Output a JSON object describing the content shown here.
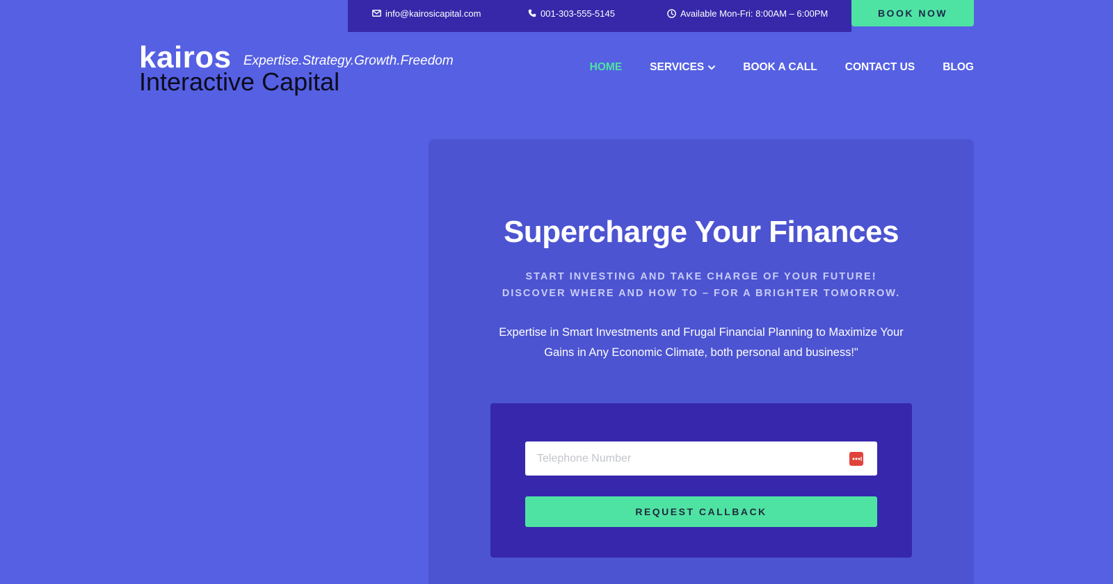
{
  "topbar": {
    "email": "info@kairosicapital.com",
    "phone": "001-303-555-5145",
    "hours": "Available Mon-Fri: 8:00AM – 6:00PM",
    "book_now_label": "BOOK NOW"
  },
  "logo": {
    "word": "kairos",
    "tagline": "Expertise.Strategy.Growth.Freedom",
    "subtitle": "Interactive Capital"
  },
  "nav": {
    "items": [
      {
        "label": "HOME",
        "active": true
      },
      {
        "label": "SERVICES",
        "has_dropdown": true
      },
      {
        "label": "BOOK A CALL"
      },
      {
        "label": "CONTACT US"
      },
      {
        "label": "BLOG"
      }
    ]
  },
  "hero": {
    "title": "Supercharge Your Finances",
    "subtitle": "START INVESTING AND TAKE CHARGE OF YOUR FUTURE! DISCOVER WHERE AND HOW TO – FOR A BRIGHTER TOMORROW.",
    "description": "Expertise in Smart Investments and Frugal Financial Planning to Maximize Your Gains in Any Economic Climate, both personal and business!\"",
    "form": {
      "phone_placeholder": "Telephone Number",
      "phone_value": "",
      "submit_label": "REQUEST CALLBACK"
    }
  },
  "icons": {
    "email": "envelope-icon",
    "phone": "phone-icon",
    "hours": "clock-icon",
    "dropdown": "chevron-down-icon",
    "field": "password-manager-icon"
  },
  "colors": {
    "page_background": "#5560e3",
    "topbar_background": "#3628a9",
    "hero_background": "#4c54d1",
    "form_background": "#3627ad",
    "accent": "#4fe3a3",
    "field_icon": "#e0433a"
  }
}
